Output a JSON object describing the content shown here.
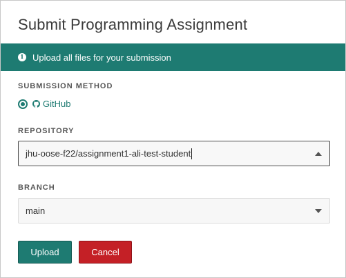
{
  "dialog": {
    "title": "Submit Programming Assignment"
  },
  "banner": {
    "icon": "info-icon",
    "text": "Upload all files for your submission",
    "color": "#1e7b72"
  },
  "submission_method": {
    "label": "SUBMISSION METHOD",
    "selected_option": "GitHub",
    "icon": "github-icon"
  },
  "repository": {
    "label": "REPOSITORY",
    "value": "jhu-oose-f22/assignment1-ali-test-student",
    "state": "open"
  },
  "branch": {
    "label": "BRANCH",
    "value": "main"
  },
  "buttons": {
    "upload_label": "Upload",
    "cancel_label": "Cancel",
    "upload_color": "#1e7b72",
    "cancel_color": "#c42026"
  }
}
